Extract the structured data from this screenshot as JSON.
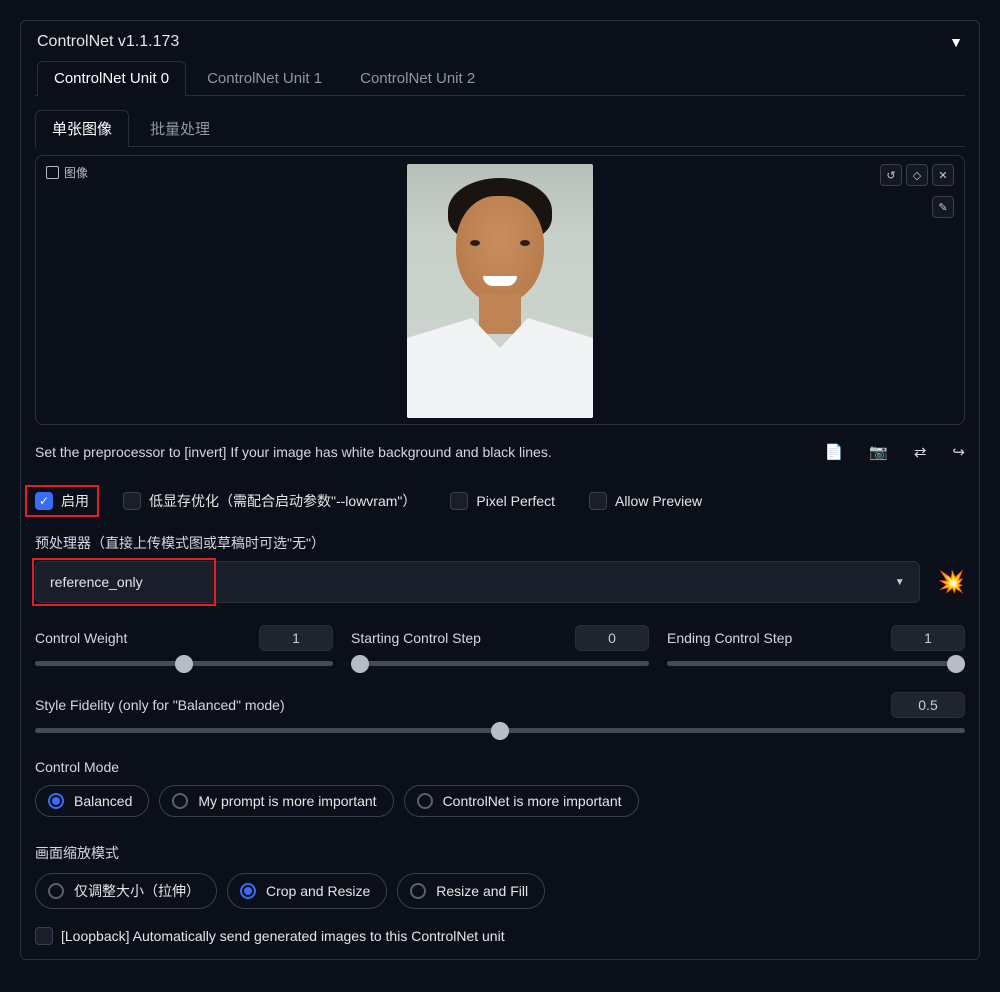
{
  "header": {
    "title": "ControlNet v1.1.173"
  },
  "tabs": [
    "ControlNet Unit 0",
    "ControlNet Unit 1",
    "ControlNet Unit 2"
  ],
  "inner_tabs": {
    "single": "单张图像",
    "batch": "批量处理"
  },
  "image_label": "图像",
  "image_actions": {
    "undo": "↺",
    "erase": "◇",
    "close": "✕",
    "edit": "✎"
  },
  "hint_text": "Set the preprocessor to [invert] If your image has white background and black lines.",
  "tool_icons": {
    "doc": "📄",
    "camera": "📷",
    "swap": "⇄",
    "send": "↪"
  },
  "checks": {
    "enable": "启用",
    "lowvram": "低显存优化（需配合启动参数\"--lowvram\"）",
    "pixel_perfect": "Pixel Perfect",
    "allow_preview": "Allow Preview"
  },
  "preproc_label": "预处理器（直接上传模式图或草稿时可选\"无\"）",
  "preproc_value": "reference_only",
  "blast_icon": "💥",
  "sliders": {
    "cw": {
      "label": "Control Weight",
      "value": "1",
      "pct": 50
    },
    "scs": {
      "label": "Starting Control Step",
      "value": "0",
      "pct": 3
    },
    "ecs": {
      "label": "Ending Control Step",
      "value": "1",
      "pct": 97
    },
    "sf": {
      "label": "Style Fidelity (only for \"Balanced\" mode)",
      "value": "0.5",
      "pct": 50
    }
  },
  "control_mode": {
    "title": "Control Mode",
    "options": [
      "Balanced",
      "My prompt is more important",
      "ControlNet is more important"
    ]
  },
  "resize_mode": {
    "title": "画面缩放模式",
    "options": [
      "仅调整大小（拉伸）",
      "Crop and Resize",
      "Resize and Fill"
    ]
  },
  "loopback": "[Loopback] Automatically send generated images to this ControlNet unit"
}
